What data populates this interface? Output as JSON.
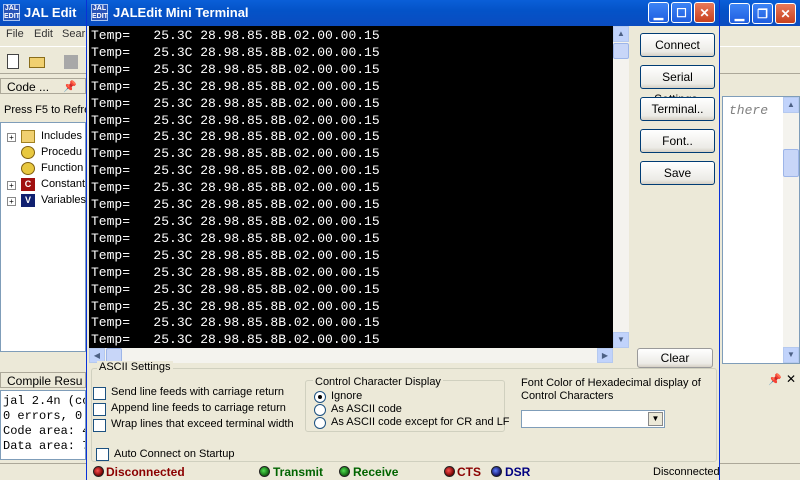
{
  "background_window": {
    "title": "JAL Edit",
    "icon_text": "JAL EDIT",
    "menu": [
      "File",
      "Edit",
      "Sear"
    ],
    "code_panel_title": "Code ...",
    "hint": "Press F5 to Refre",
    "tree": [
      {
        "label": "Includes",
        "icon": "folder-icon"
      },
      {
        "label": "Procedu",
        "icon": "gear-icon"
      },
      {
        "label": "Function",
        "icon": "gear-icon"
      },
      {
        "label": "Constant",
        "icon": "constant-icon",
        "icon_text": "C"
      },
      {
        "label": "Variables",
        "icon": "variable-icon",
        "icon_text": "V"
      }
    ],
    "compile_title": "Compile Resu",
    "compile_lines": [
      "jal 2.4n (co",
      "0 errors, 0",
      "Code area: 4",
      "Data area: 7"
    ],
    "editor_snippet": "there",
    "status": {
      "disconnected": "Disconnected",
      "transmit": "Transmit",
      "receive": "Receive",
      "cts": "CTS",
      "dsr": "DSR",
      "right": "Disconnected"
    }
  },
  "terminal": {
    "title": "JALEdit Mini Terminal",
    "icon_text": "JAL EDIT",
    "output_line": "Temp=   25.3C 28.98.85.8B.02.00.00.15",
    "line_count": 19,
    "buttons": {
      "connect": "Connect",
      "serial_settings": "Serial Settings.",
      "terminal": "Terminal..",
      "font": "Font..",
      "save": "Save",
      "clear": "Clear"
    },
    "ascii_settings": {
      "title": "ASCII Settings",
      "send_lf": "Send line feeds with carriage return",
      "append_lf": "Append line feeds to carriage return",
      "wrap": "Wrap lines that exceed terminal width",
      "auto_connect": "Auto Connect on Startup"
    },
    "control_display": {
      "title": "Control Character Display",
      "options": [
        "Ignore",
        "As ASCII code",
        "As ASCII code except for CR and LF"
      ],
      "selected": "Ignore"
    },
    "font_color": {
      "label": "Font Color of Hexadecimal display of Control Characters",
      "value": ""
    }
  },
  "colors": {
    "titlebar": "#0453c8",
    "terminal_bg": "#000000",
    "terminal_fg": "#ffffff",
    "status_disconnected": "#8b0000",
    "status_ok": "#006400"
  }
}
